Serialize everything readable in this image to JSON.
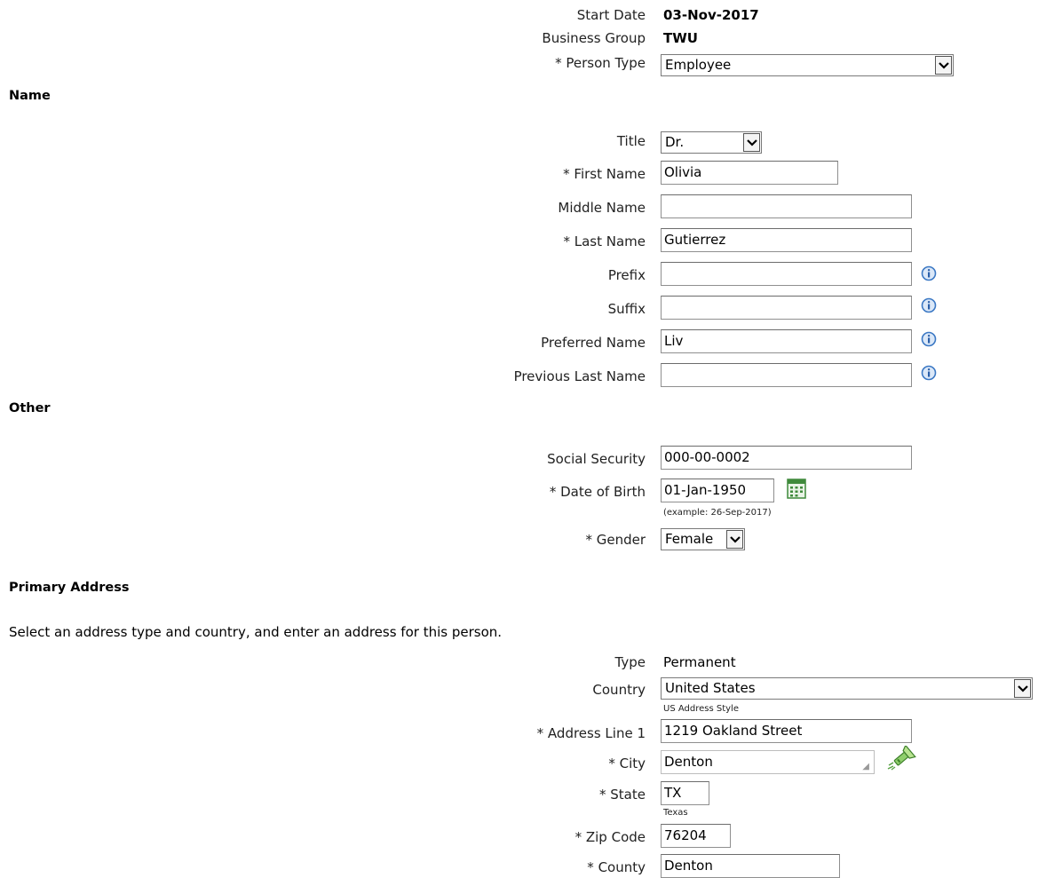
{
  "header": {
    "start_date_label": "Start Date",
    "start_date_value": "03-Nov-2017",
    "business_group_label": "Business Group",
    "business_group_value": "TWU",
    "person_type_label": "* Person Type",
    "person_type_value": "Employee"
  },
  "name_section": {
    "heading": "Name",
    "title_label": "Title",
    "title_value": "Dr.",
    "first_name_label": "* First Name",
    "first_name_value": "Olivia",
    "middle_name_label": "Middle Name",
    "middle_name_value": "",
    "last_name_label": "* Last Name",
    "last_name_value": "Gutierrez",
    "prefix_label": "Prefix",
    "prefix_value": "",
    "suffix_label": "Suffix",
    "suffix_value": "",
    "preferred_name_label": "Preferred Name",
    "preferred_name_value": "Liv",
    "previous_last_name_label": "Previous Last Name",
    "previous_last_name_value": ""
  },
  "other_section": {
    "heading": "Other",
    "ssn_label": "Social Security",
    "ssn_value": "000-00-0002",
    "dob_label": "* Date of Birth",
    "dob_value": "01-Jan-1950",
    "dob_hint": "(example: 26-Sep-2017)",
    "gender_label": "* Gender",
    "gender_value": "Female"
  },
  "address_section": {
    "heading": "Primary Address",
    "instructions": "Select an address type and country, and enter an address for this person.",
    "type_label": "Type",
    "type_value": "Permanent",
    "country_label": "Country",
    "country_value": "United States",
    "address_style": "US Address Style",
    "address_line1_label": "* Address Line 1",
    "address_line1_value": "1219 Oakland Street",
    "city_label": "* City",
    "city_value": "Denton",
    "state_label": "* State",
    "state_value": "TX",
    "state_hint": "Texas",
    "zip_label": "* Zip Code",
    "zip_value": "76204",
    "county_label": "* County",
    "county_value": "Denton"
  },
  "icons": {
    "info": "info-icon",
    "calendar": "calendar-icon",
    "search": "flashlight-search-icon",
    "dropdown": "chevron-down-icon"
  },
  "colors": {
    "info_blue": "#3b78c4",
    "calendar_green": "#3f8a3b",
    "search_green": "#5aa346"
  }
}
